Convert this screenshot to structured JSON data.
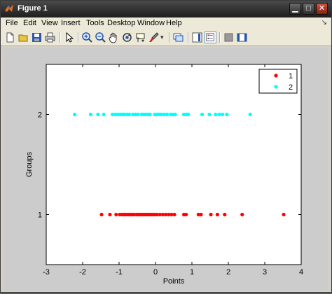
{
  "window": {
    "title": "Figure 1"
  },
  "menu": {
    "items": [
      "File",
      "Edit",
      "View",
      "Insert",
      "Tools",
      "Desktop",
      "Window",
      "Help"
    ],
    "dock_arrow": "↘"
  },
  "toolbar": {
    "icons": [
      "new-figure-icon",
      "open-file-icon",
      "save-icon",
      "print-icon",
      "edit-plot-arrow-icon",
      "zoom-in-icon",
      "zoom-out-icon",
      "pan-hand-icon",
      "rotate-3d-icon",
      "data-cursor-icon",
      "brush-icon",
      "link-plot-icon",
      "colorbar-icon",
      "legend-icon",
      "hide-plot-tools-icon",
      "show-plot-tools-icon"
    ]
  },
  "chart_data": {
    "type": "scatter",
    "title": "",
    "xlabel": "Points",
    "ylabel": "Groups",
    "xlim": [
      -3,
      4
    ],
    "ylim": [
      0.5,
      2.5
    ],
    "xticks": [
      "-3",
      "-2",
      "-1",
      "0",
      "1",
      "2",
      "3",
      "4"
    ],
    "yticks": [
      "1",
      "2"
    ],
    "grid": false,
    "legend_position": "top-right",
    "series": [
      {
        "name": "1",
        "color": "#ff0000",
        "y": 1,
        "x": [
          -1.48,
          -1.25,
          -1.08,
          -0.98,
          -0.92,
          -0.86,
          -0.82,
          -0.77,
          -0.73,
          -0.68,
          -0.63,
          -0.58,
          -0.52,
          -0.47,
          -0.42,
          -0.37,
          -0.32,
          -0.27,
          -0.22,
          -0.17,
          -0.12,
          -0.07,
          -0.02,
          0.04,
          0.12,
          0.2,
          0.28,
          0.36,
          0.44,
          0.52,
          0.78,
          0.84,
          1.18,
          1.25,
          1.52,
          1.7,
          1.9,
          2.38,
          3.52
        ]
      },
      {
        "name": "2",
        "color": "#00ffff",
        "y": 2,
        "x": [
          -2.22,
          -1.78,
          -1.58,
          -1.42,
          -1.18,
          -1.1,
          -1.03,
          -0.97,
          -0.91,
          -0.86,
          -0.78,
          -0.72,
          -0.62,
          -0.55,
          -0.48,
          -0.38,
          -0.32,
          -0.27,
          -0.21,
          -0.15,
          -0.02,
          0.04,
          0.1,
          0.16,
          0.24,
          0.32,
          0.42,
          0.48,
          0.54,
          0.78,
          0.85,
          0.9,
          1.28,
          1.48,
          1.65,
          1.75,
          1.84,
          1.96,
          2.6
        ]
      }
    ]
  }
}
